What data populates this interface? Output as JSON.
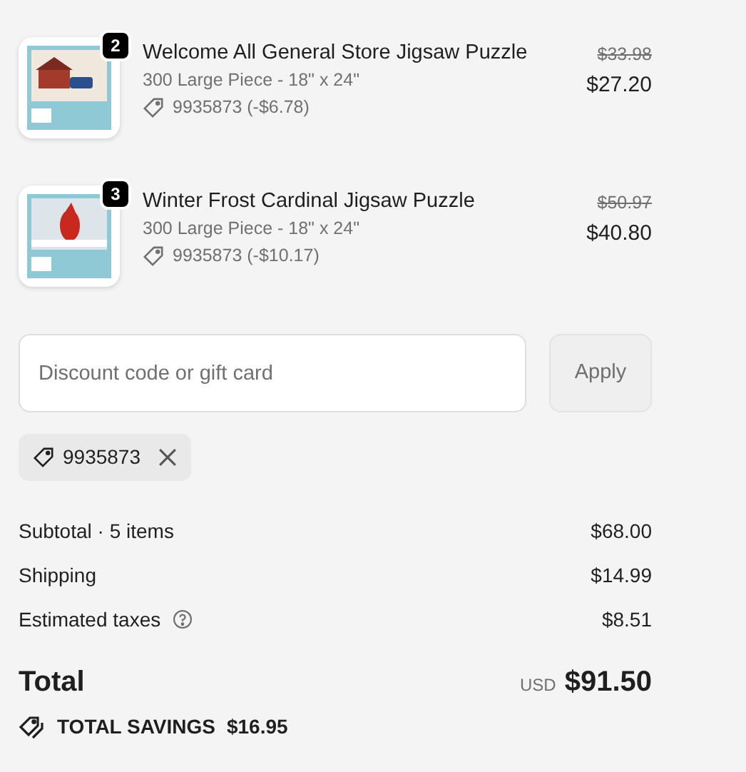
{
  "line_items": [
    {
      "quantity": "2",
      "title": "Welcome All General Store Jigsaw Puzzle",
      "variant": "300 Large Piece - 18\" x 24\"",
      "discount": "9935873 (-$6.78)",
      "original_price": "$33.98",
      "price": "$27.20",
      "kind": "store"
    },
    {
      "quantity": "3",
      "title": "Winter Frost Cardinal Jigsaw Puzzle",
      "variant": "300 Large Piece - 18\" x 24\"",
      "discount": "9935873 (-$10.17)",
      "original_price": "$50.97",
      "price": "$40.80",
      "kind": "cardinal"
    }
  ],
  "discount_form": {
    "placeholder": "Discount code or gift card",
    "button": "Apply",
    "disabled": true
  },
  "applied_codes": [
    "9935873"
  ],
  "summary": [
    {
      "label": "Subtotal · 5 items",
      "value": "$68.00",
      "help": false
    },
    {
      "label": "Shipping",
      "value": "$14.99",
      "help": false
    },
    {
      "label": "Estimated taxes",
      "value": "$8.51",
      "help": true
    }
  ],
  "total": {
    "label": "Total",
    "currency": "USD",
    "value": "$91.50"
  },
  "savings": {
    "label": "TOTAL SAVINGS",
    "value": "$16.95"
  }
}
